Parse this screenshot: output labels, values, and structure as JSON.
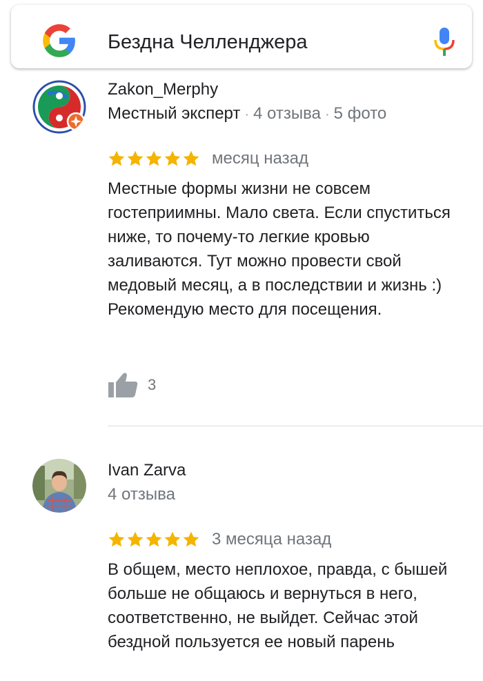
{
  "search": {
    "query": "Бездна Челленджера"
  },
  "reviews": [
    {
      "author": "Zakon_Merphy",
      "badge": "Местный эксперт",
      "reviews_count": "4 отзыва",
      "photos_count": "5 фото",
      "rating": 5,
      "date": "месяц назад",
      "text": "Местные формы жизни не совсем гостеприимны. Мало света. Если спуститься ниже, то почему-то легкие кровью заливаются. Тут можно провести свой медовый месяц, а в последствии и жизнь :) Рекомендую место для посещения.",
      "likes": "3"
    },
    {
      "author": "Ivan Zarva",
      "reviews_count": "4 отзыва",
      "rating": 5,
      "date": "3 месяца назад",
      "text": "В общем, место неплохое, правда, с бышей больше не общаюсь и вернуться в него, соответственно, не выйдет. Сейчас этой бездной пользуется ее новый парень"
    }
  ],
  "colors": {
    "star": "#f4b400",
    "meta_gray": "#70757a",
    "divider": "#dadce0",
    "mic_blue": "#4285f4",
    "mic_red": "#ea4335",
    "mic_yellow": "#fbbc05",
    "mic_green": "#34a853"
  },
  "icons": {
    "logo": "google-g-icon",
    "mic": "microphone-icon",
    "like": "thumbs-up-icon",
    "star": "star-icon"
  }
}
